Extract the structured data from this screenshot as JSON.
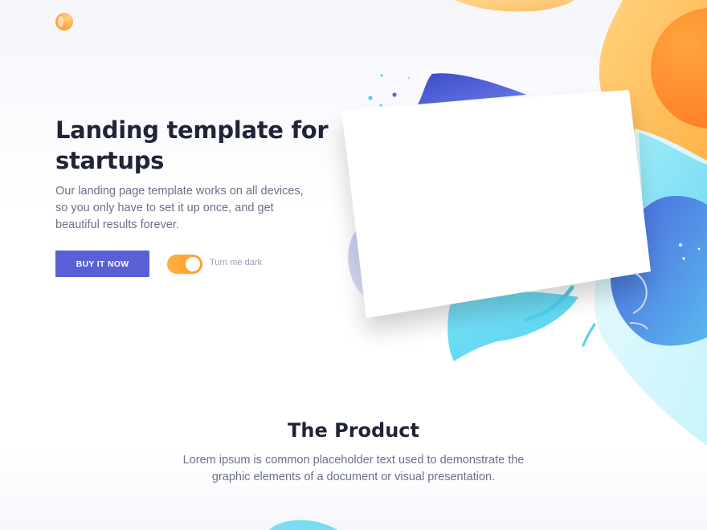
{
  "header": {
    "logo_icon": "orange-circle-logo-icon"
  },
  "hero": {
    "title": "Landing template for startups",
    "description": "Our landing page template works on all devices, so you only have to set it up once, and get beautiful results forever.",
    "buy_button_label": "BUY IT NOW",
    "toggle_label": "Turn me dark",
    "toggle_on": true
  },
  "product": {
    "title": "The Product",
    "description": "Lorem ipsum is common placeholder text used to demonstrate the graphic elements of a document or visual presentation."
  },
  "colors": {
    "primary": "#5a5fd6",
    "accent_orange": "#ff9d2e",
    "heading": "#1f2438",
    "body_text": "#6b7188",
    "muted_text": "#9aa0b4"
  }
}
